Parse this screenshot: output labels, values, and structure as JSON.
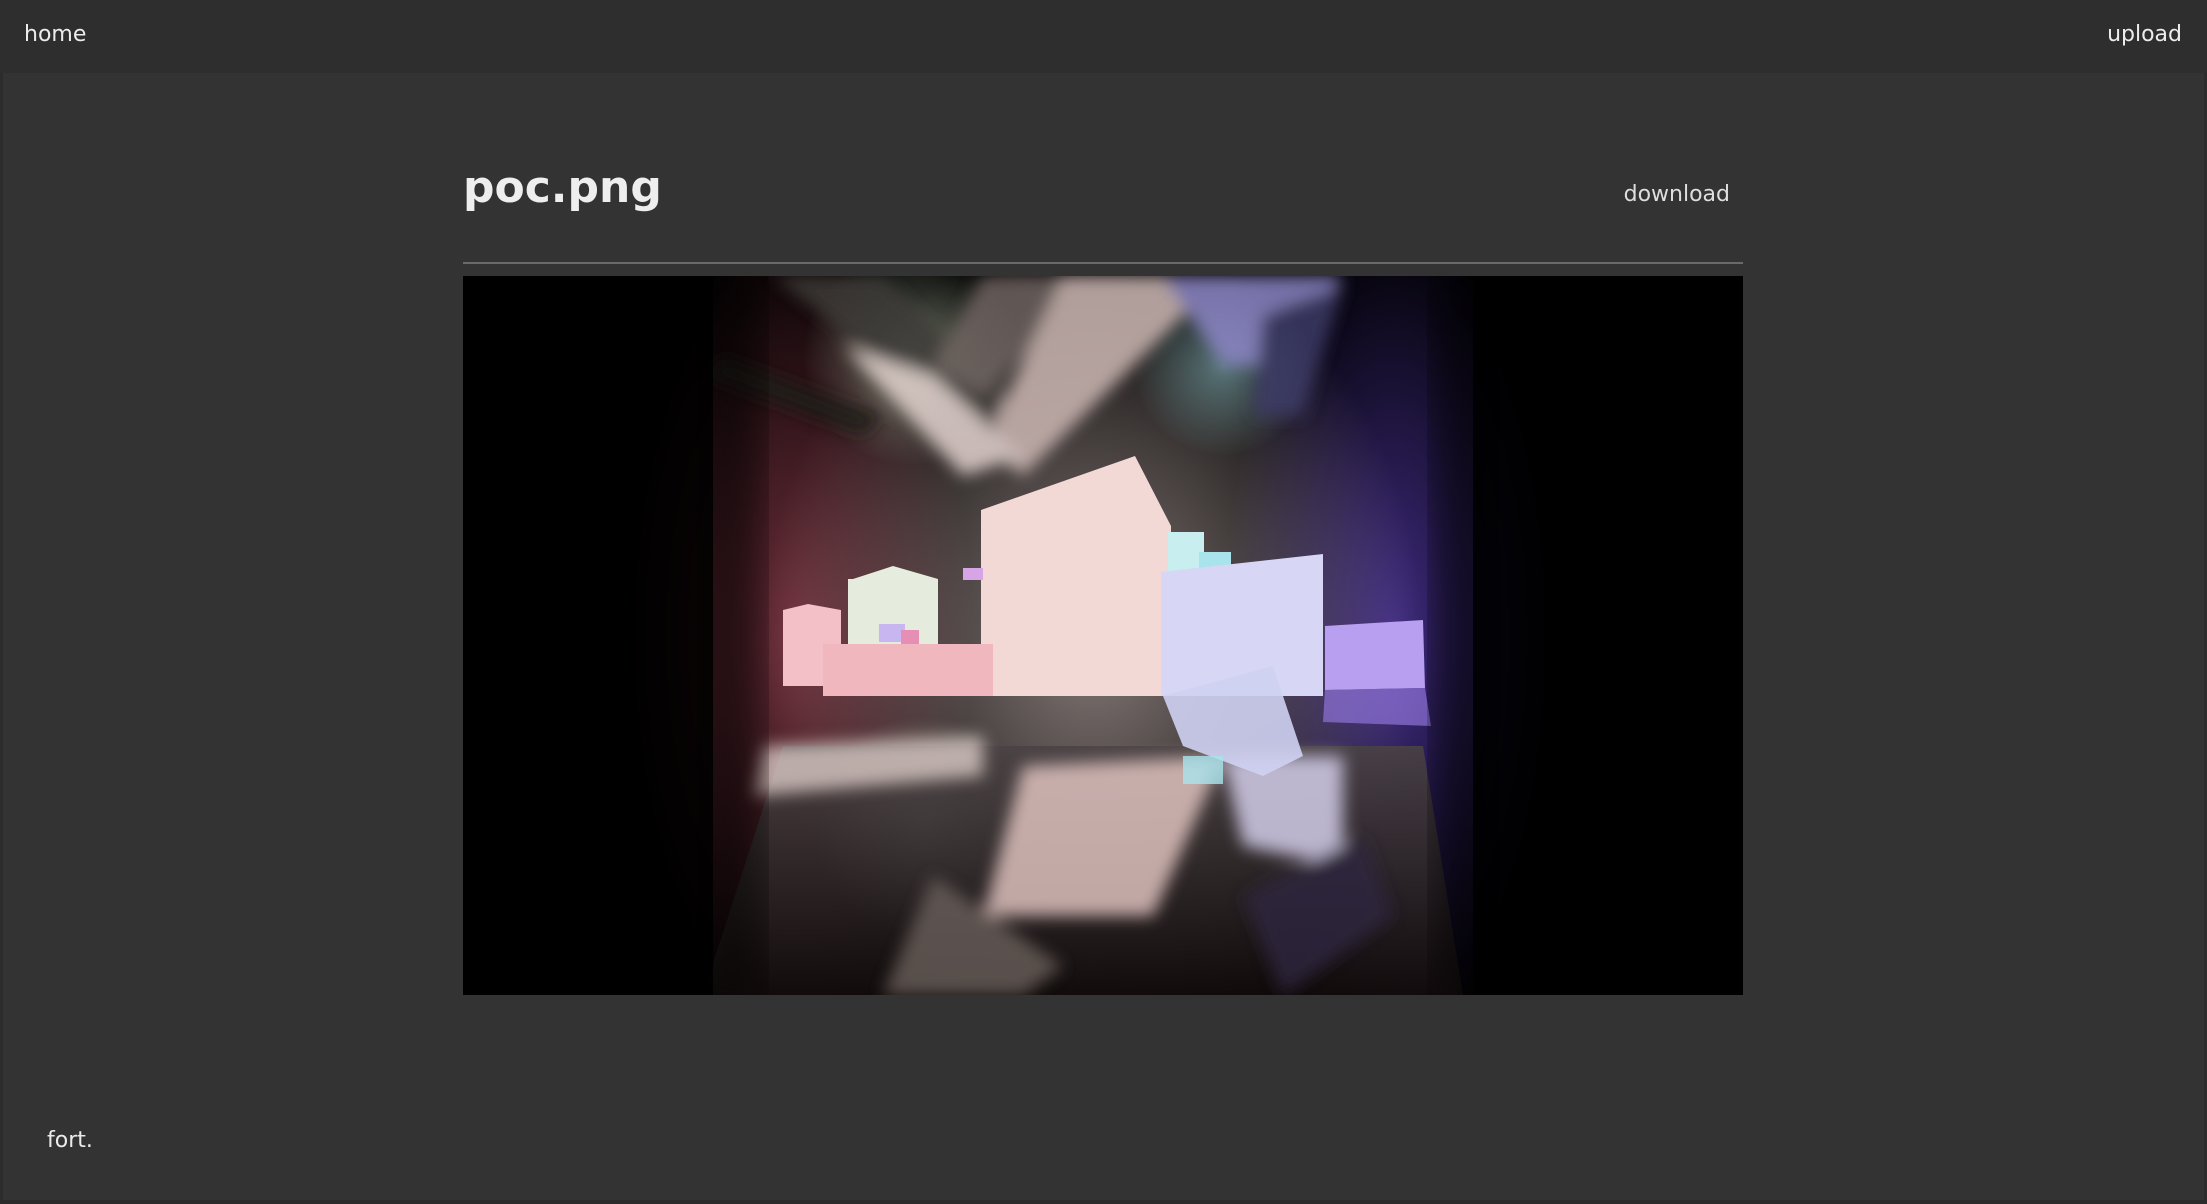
{
  "header": {
    "home_label": "home",
    "upload_label": "upload"
  },
  "file": {
    "name": "poc.png",
    "download_label": "download"
  },
  "footer": {
    "brand": "fort."
  }
}
